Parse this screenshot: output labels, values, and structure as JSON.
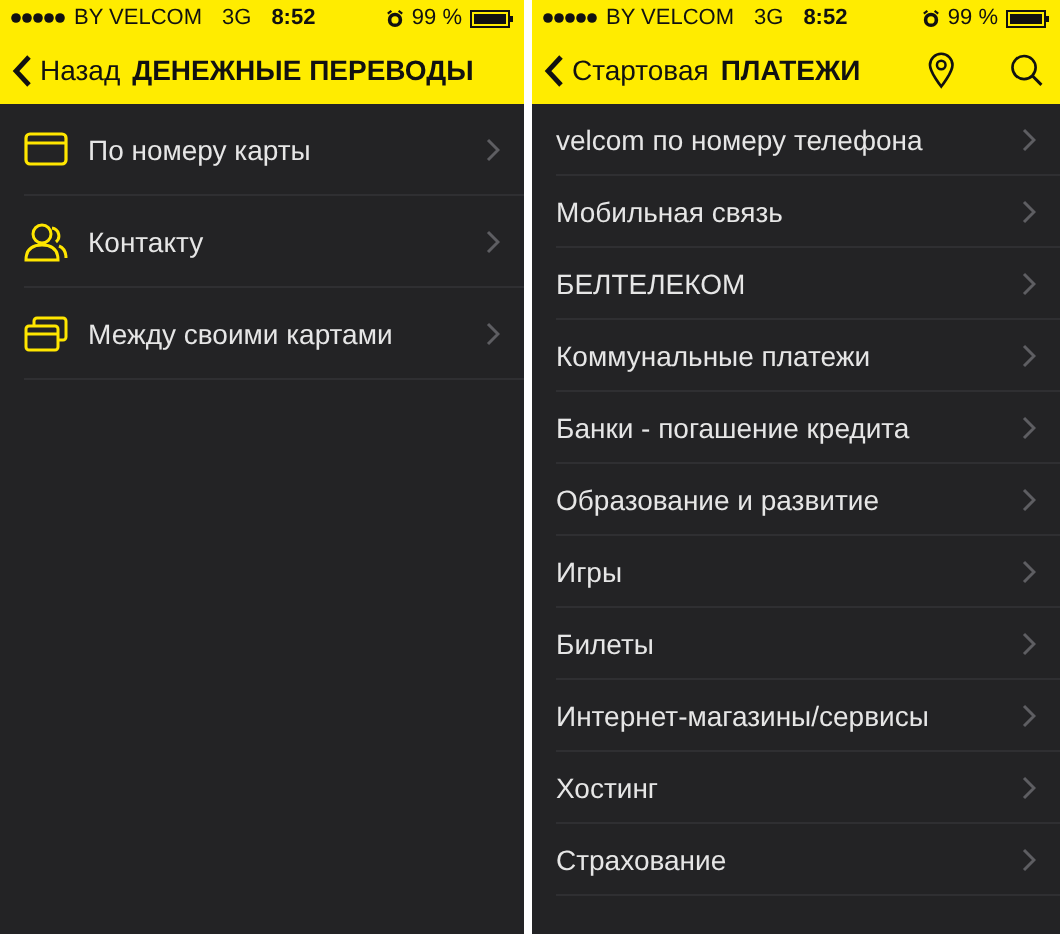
{
  "screens": [
    {
      "status_bar": {
        "carrier": "BY VELCOM",
        "network": "3G",
        "time": "8:52",
        "battery": "99 %"
      },
      "nav": {
        "back": "Назад",
        "title": "ДЕНЕЖНЫЕ ПЕРЕВОДЫ"
      },
      "items": [
        {
          "label": "По номеру карты",
          "kind": "card"
        },
        {
          "label": "Контакту",
          "kind": "contacts"
        },
        {
          "label": "Между своими картами",
          "kind": "cards"
        }
      ]
    },
    {
      "status_bar": {
        "carrier": "BY VELCOM",
        "network": "3G",
        "time": "8:52",
        "battery": "99 %"
      },
      "nav": {
        "back": "Стартовая",
        "title": "ПЛАТЕЖИ",
        "actions": [
          {
            "kind": "location"
          },
          {
            "kind": "search"
          }
        ]
      },
      "items": [
        {
          "label": "velcom по номеру телефона",
          "kind": "plain"
        },
        {
          "label": "Мобильная связь",
          "kind": "plain"
        },
        {
          "label": "БЕЛТЕЛЕКОМ",
          "kind": "plain"
        },
        {
          "label": "Коммунальные платежи",
          "kind": "plain"
        },
        {
          "label": "Банки - погашение кредита",
          "kind": "plain"
        },
        {
          "label": "Образование и развитие",
          "kind": "plain"
        },
        {
          "label": "Игры",
          "kind": "plain"
        },
        {
          "label": "Билеты",
          "kind": "plain"
        },
        {
          "label": "Интернет-магазины/сервисы",
          "kind": "plain"
        },
        {
          "label": "Хостинг",
          "kind": "plain"
        },
        {
          "label": "Страхование",
          "kind": "plain"
        }
      ]
    }
  ]
}
